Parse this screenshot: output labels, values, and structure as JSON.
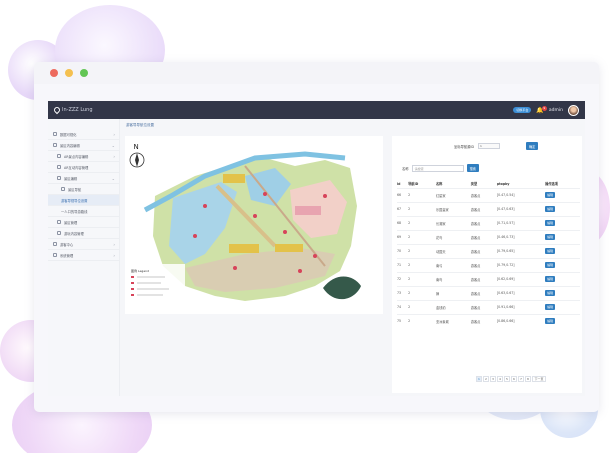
{
  "app": {
    "logo_text": "In-ZZZ Lung",
    "badge_label": "切换平台",
    "notification_count": "9",
    "username": "admin"
  },
  "sidebar": {
    "items": [
      {
        "label": "数据可视化",
        "level": 0
      },
      {
        "label": "景区内容编辑",
        "level": 0
      },
      {
        "label": "AR景点内容编辑",
        "level": 1
      },
      {
        "label": "AR互动内容管理",
        "level": 1
      },
      {
        "label": "景区编辑",
        "level": 1
      },
      {
        "label": "景区导航",
        "level": 2
      },
      {
        "label": "游客导视导位设置",
        "level": 2,
        "active": true
      },
      {
        "label": "一人口的导游路线",
        "level": 2
      },
      {
        "label": "景区管理",
        "level": 1
      },
      {
        "label": "游玩内容管理",
        "level": 1
      },
      {
        "label": "游客中心",
        "level": 0
      },
      {
        "label": "系统管理",
        "level": 0
      }
    ]
  },
  "breadcrumb": "游客导导航位设置",
  "map": {
    "compass_label": "N",
    "legend_title": "图例 Legend"
  },
  "filter": {
    "label": "坐标导航源ID",
    "value": "1",
    "button": "确定"
  },
  "search": {
    "label": "名称",
    "placeholder": "请搜索",
    "button": "搜索"
  },
  "table": {
    "columns": [
      "id",
      "导航ID",
      "名称",
      "类型",
      "ptopby",
      "操作选项"
    ],
    "action_label": "编辑",
    "rows": [
      [
        "66",
        "2",
        "红星家",
        "游客点",
        "[0.47,0.54]"
      ],
      [
        "67",
        "2",
        "乐园皇家",
        "游客点",
        "[0.47,0.63]"
      ],
      [
        "68",
        "2",
        "长潮家",
        "游客点",
        "[0.71,0.57]"
      ],
      [
        "69",
        "2",
        "花鸟",
        "游客点",
        "[0.46,0.73]"
      ],
      [
        "70",
        "2",
        "动园天",
        "游客点",
        "[0.79,0.65]"
      ],
      [
        "71",
        "2",
        "南弓",
        "游客点",
        "[0.79,0.72]"
      ],
      [
        "72",
        "2",
        "南鸟",
        "游客点",
        "[0.62,0.69]"
      ],
      [
        "73",
        "2",
        "狮",
        "游客点",
        "[0.63,0.67]"
      ],
      [
        "74",
        "2",
        "金钱豹",
        "游客点",
        "[0.91,0.66]"
      ],
      [
        "75",
        "2",
        "亚洲象城",
        "游客点",
        "[0.86,0.66]"
      ]
    ]
  },
  "pagination": {
    "pages": [
      "1",
      "2",
      "3",
      "4",
      "5",
      "6",
      "7",
      "8"
    ],
    "next": "下一页"
  }
}
